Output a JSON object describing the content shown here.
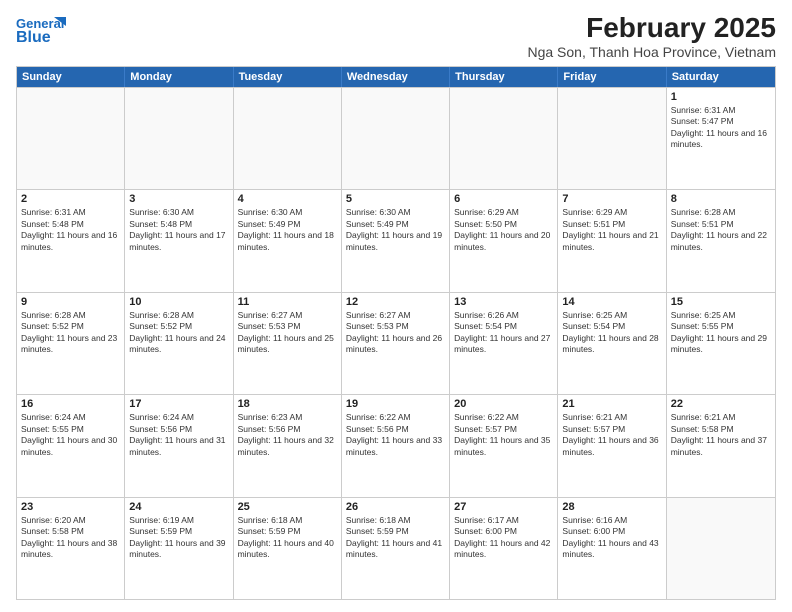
{
  "title": "February 2025",
  "subtitle": "Nga Son, Thanh Hoa Province, Vietnam",
  "logo": {
    "line1": "General",
    "line2": "Blue"
  },
  "days_of_week": [
    "Sunday",
    "Monday",
    "Tuesday",
    "Wednesday",
    "Thursday",
    "Friday",
    "Saturday"
  ],
  "weeks": [
    [
      {
        "day": "",
        "info": ""
      },
      {
        "day": "",
        "info": ""
      },
      {
        "day": "",
        "info": ""
      },
      {
        "day": "",
        "info": ""
      },
      {
        "day": "",
        "info": ""
      },
      {
        "day": "",
        "info": ""
      },
      {
        "day": "1",
        "info": "Sunrise: 6:31 AM\nSunset: 5:47 PM\nDaylight: 11 hours and 16 minutes."
      }
    ],
    [
      {
        "day": "2",
        "info": "Sunrise: 6:31 AM\nSunset: 5:48 PM\nDaylight: 11 hours and 16 minutes."
      },
      {
        "day": "3",
        "info": "Sunrise: 6:30 AM\nSunset: 5:48 PM\nDaylight: 11 hours and 17 minutes."
      },
      {
        "day": "4",
        "info": "Sunrise: 6:30 AM\nSunset: 5:49 PM\nDaylight: 11 hours and 18 minutes."
      },
      {
        "day": "5",
        "info": "Sunrise: 6:30 AM\nSunset: 5:49 PM\nDaylight: 11 hours and 19 minutes."
      },
      {
        "day": "6",
        "info": "Sunrise: 6:29 AM\nSunset: 5:50 PM\nDaylight: 11 hours and 20 minutes."
      },
      {
        "day": "7",
        "info": "Sunrise: 6:29 AM\nSunset: 5:51 PM\nDaylight: 11 hours and 21 minutes."
      },
      {
        "day": "8",
        "info": "Sunrise: 6:28 AM\nSunset: 5:51 PM\nDaylight: 11 hours and 22 minutes."
      }
    ],
    [
      {
        "day": "9",
        "info": "Sunrise: 6:28 AM\nSunset: 5:52 PM\nDaylight: 11 hours and 23 minutes."
      },
      {
        "day": "10",
        "info": "Sunrise: 6:28 AM\nSunset: 5:52 PM\nDaylight: 11 hours and 24 minutes."
      },
      {
        "day": "11",
        "info": "Sunrise: 6:27 AM\nSunset: 5:53 PM\nDaylight: 11 hours and 25 minutes."
      },
      {
        "day": "12",
        "info": "Sunrise: 6:27 AM\nSunset: 5:53 PM\nDaylight: 11 hours and 26 minutes."
      },
      {
        "day": "13",
        "info": "Sunrise: 6:26 AM\nSunset: 5:54 PM\nDaylight: 11 hours and 27 minutes."
      },
      {
        "day": "14",
        "info": "Sunrise: 6:25 AM\nSunset: 5:54 PM\nDaylight: 11 hours and 28 minutes."
      },
      {
        "day": "15",
        "info": "Sunrise: 6:25 AM\nSunset: 5:55 PM\nDaylight: 11 hours and 29 minutes."
      }
    ],
    [
      {
        "day": "16",
        "info": "Sunrise: 6:24 AM\nSunset: 5:55 PM\nDaylight: 11 hours and 30 minutes."
      },
      {
        "day": "17",
        "info": "Sunrise: 6:24 AM\nSunset: 5:56 PM\nDaylight: 11 hours and 31 minutes."
      },
      {
        "day": "18",
        "info": "Sunrise: 6:23 AM\nSunset: 5:56 PM\nDaylight: 11 hours and 32 minutes."
      },
      {
        "day": "19",
        "info": "Sunrise: 6:22 AM\nSunset: 5:56 PM\nDaylight: 11 hours and 33 minutes."
      },
      {
        "day": "20",
        "info": "Sunrise: 6:22 AM\nSunset: 5:57 PM\nDaylight: 11 hours and 35 minutes."
      },
      {
        "day": "21",
        "info": "Sunrise: 6:21 AM\nSunset: 5:57 PM\nDaylight: 11 hours and 36 minutes."
      },
      {
        "day": "22",
        "info": "Sunrise: 6:21 AM\nSunset: 5:58 PM\nDaylight: 11 hours and 37 minutes."
      }
    ],
    [
      {
        "day": "23",
        "info": "Sunrise: 6:20 AM\nSunset: 5:58 PM\nDaylight: 11 hours and 38 minutes."
      },
      {
        "day": "24",
        "info": "Sunrise: 6:19 AM\nSunset: 5:59 PM\nDaylight: 11 hours and 39 minutes."
      },
      {
        "day": "25",
        "info": "Sunrise: 6:18 AM\nSunset: 5:59 PM\nDaylight: 11 hours and 40 minutes."
      },
      {
        "day": "26",
        "info": "Sunrise: 6:18 AM\nSunset: 5:59 PM\nDaylight: 11 hours and 41 minutes."
      },
      {
        "day": "27",
        "info": "Sunrise: 6:17 AM\nSunset: 6:00 PM\nDaylight: 11 hours and 42 minutes."
      },
      {
        "day": "28",
        "info": "Sunrise: 6:16 AM\nSunset: 6:00 PM\nDaylight: 11 hours and 43 minutes."
      },
      {
        "day": "",
        "info": ""
      }
    ]
  ]
}
